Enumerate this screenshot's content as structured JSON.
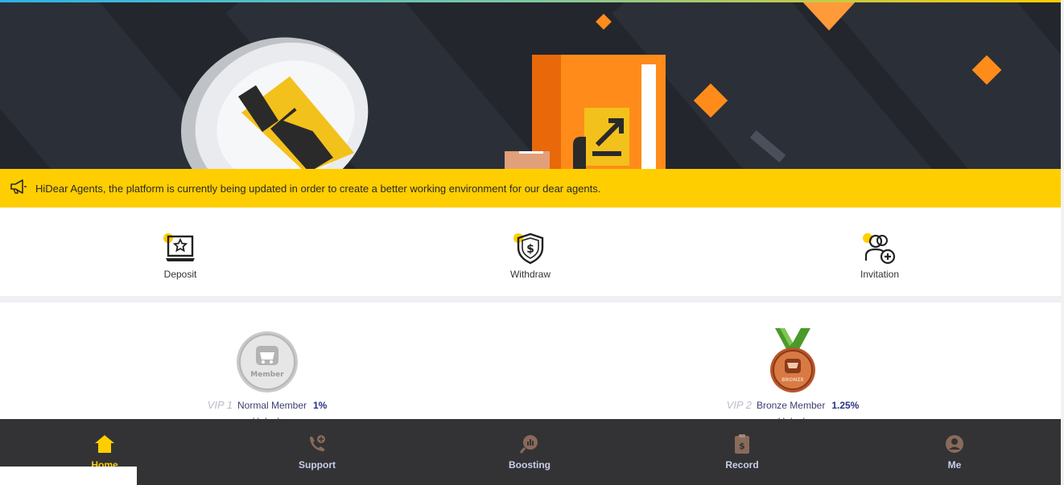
{
  "notice": {
    "icon": "megaphone-icon",
    "text": "HiDear Agents, the platform is currently being updated in order to create a better working environment for our dear agents."
  },
  "actions": [
    {
      "label": "Deposit",
      "icon": "laptop-star-icon"
    },
    {
      "label": "Withdraw",
      "icon": "shield-dollar-icon"
    },
    {
      "label": "Invitation",
      "icon": "add-user-icon"
    }
  ],
  "vip": [
    {
      "level": "VIP 1",
      "name": "Normal Member",
      "rate": "1%",
      "badge_text": "Member",
      "action": "Unlock",
      "badge": "silver-member-medal"
    },
    {
      "level": "VIP 2",
      "name": "Bronze Member",
      "rate": "1.25%",
      "badge_text": "BRONZE",
      "action": "Unlock",
      "badge": "bronze-member-medal"
    }
  ],
  "nav": [
    {
      "label": "Home",
      "icon": "home-icon",
      "active": true
    },
    {
      "label": "Support",
      "icon": "support-phone-icon",
      "active": false
    },
    {
      "label": "Boosting",
      "icon": "boosting-chart-icon",
      "active": false
    },
    {
      "label": "Record",
      "icon": "record-clipboard-icon",
      "active": false
    },
    {
      "label": "Me",
      "icon": "user-icon",
      "active": false
    }
  ],
  "colors": {
    "accent_yellow": "#ffce00",
    "banner_dark": "#23262d",
    "nav_bg": "#333335",
    "orange": "#ff8c1a"
  }
}
